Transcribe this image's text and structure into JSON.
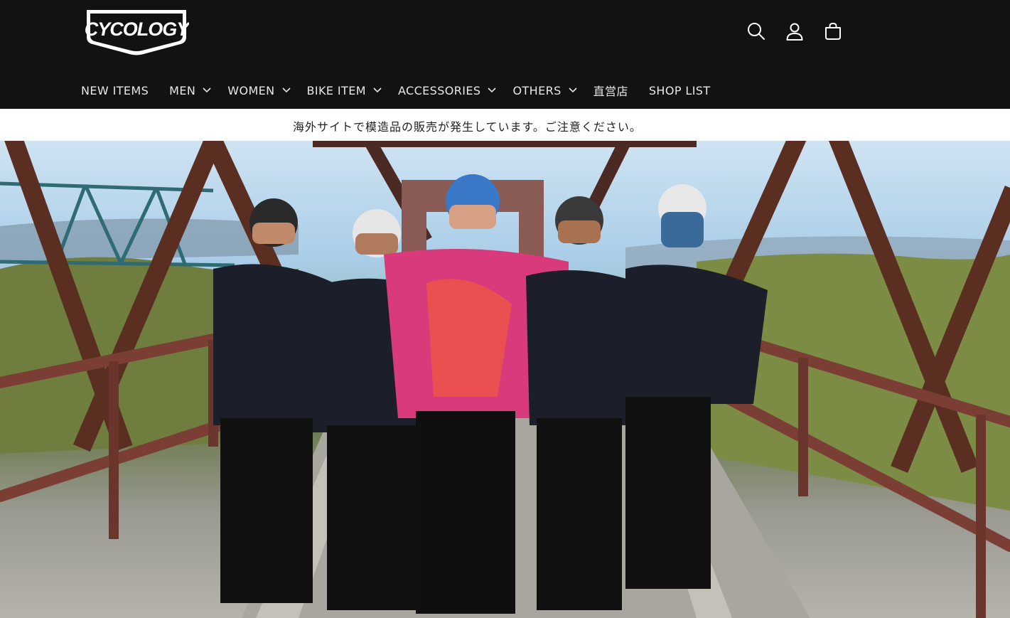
{
  "header": {
    "logo_text": "CYCOLOGY",
    "icons": [
      "search-icon",
      "account-icon",
      "cart-icon"
    ]
  },
  "nav": {
    "items": [
      {
        "label": "NEW ITEMS",
        "has_dropdown": false
      },
      {
        "label": "MEN",
        "has_dropdown": true
      },
      {
        "label": "WOMEN",
        "has_dropdown": true
      },
      {
        "label": "BIKE ITEM",
        "has_dropdown": true
      },
      {
        "label": "ACCESSORIES",
        "has_dropdown": true
      },
      {
        "label": "OTHERS",
        "has_dropdown": true
      },
      {
        "label": "直営店",
        "has_dropdown": false
      },
      {
        "label": "SHOP LIST",
        "has_dropdown": false
      }
    ]
  },
  "announcement": {
    "text": "海外サイトで模造品の販売が発生しています。ご注意ください。"
  },
  "colors": {
    "header_bg": "#121212",
    "nav_text": "#e8e8e8",
    "announcement_bg": "#ffffff"
  }
}
